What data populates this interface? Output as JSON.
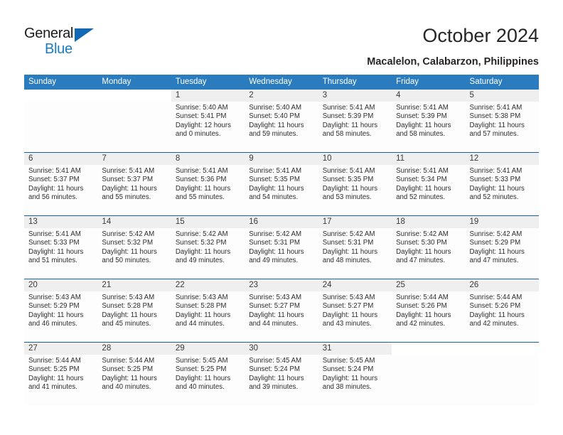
{
  "brand": {
    "name_top": "General",
    "name_bottom": "Blue",
    "accent_color": "#1a7dc4",
    "triangle_color": "#1268b3"
  },
  "header": {
    "title": "October 2024",
    "subtitle": "Macalelon, Calabarzon, Philippines"
  },
  "calendar": {
    "header_bg": "#2b7cbf",
    "header_text_color": "#ffffff",
    "row_divider_color": "#19629f",
    "day_number_band_color": "#efefef",
    "weekdays": [
      "Sunday",
      "Monday",
      "Tuesday",
      "Wednesday",
      "Thursday",
      "Friday",
      "Saturday"
    ],
    "weeks": [
      [
        {
          "day": "",
          "lines": []
        },
        {
          "day": "",
          "lines": []
        },
        {
          "day": "1",
          "lines": [
            "Sunrise: 5:40 AM",
            "Sunset: 5:41 PM",
            "Daylight: 12 hours",
            "and 0 minutes."
          ]
        },
        {
          "day": "2",
          "lines": [
            "Sunrise: 5:40 AM",
            "Sunset: 5:40 PM",
            "Daylight: 11 hours",
            "and 59 minutes."
          ]
        },
        {
          "day": "3",
          "lines": [
            "Sunrise: 5:41 AM",
            "Sunset: 5:39 PM",
            "Daylight: 11 hours",
            "and 58 minutes."
          ]
        },
        {
          "day": "4",
          "lines": [
            "Sunrise: 5:41 AM",
            "Sunset: 5:39 PM",
            "Daylight: 11 hours",
            "and 58 minutes."
          ]
        },
        {
          "day": "5",
          "lines": [
            "Sunrise: 5:41 AM",
            "Sunset: 5:38 PM",
            "Daylight: 11 hours",
            "and 57 minutes."
          ]
        }
      ],
      [
        {
          "day": "6",
          "lines": [
            "Sunrise: 5:41 AM",
            "Sunset: 5:37 PM",
            "Daylight: 11 hours",
            "and 56 minutes."
          ]
        },
        {
          "day": "7",
          "lines": [
            "Sunrise: 5:41 AM",
            "Sunset: 5:37 PM",
            "Daylight: 11 hours",
            "and 55 minutes."
          ]
        },
        {
          "day": "8",
          "lines": [
            "Sunrise: 5:41 AM",
            "Sunset: 5:36 PM",
            "Daylight: 11 hours",
            "and 55 minutes."
          ]
        },
        {
          "day": "9",
          "lines": [
            "Sunrise: 5:41 AM",
            "Sunset: 5:35 PM",
            "Daylight: 11 hours",
            "and 54 minutes."
          ]
        },
        {
          "day": "10",
          "lines": [
            "Sunrise: 5:41 AM",
            "Sunset: 5:35 PM",
            "Daylight: 11 hours",
            "and 53 minutes."
          ]
        },
        {
          "day": "11",
          "lines": [
            "Sunrise: 5:41 AM",
            "Sunset: 5:34 PM",
            "Daylight: 11 hours",
            "and 52 minutes."
          ]
        },
        {
          "day": "12",
          "lines": [
            "Sunrise: 5:41 AM",
            "Sunset: 5:33 PM",
            "Daylight: 11 hours",
            "and 52 minutes."
          ]
        }
      ],
      [
        {
          "day": "13",
          "lines": [
            "Sunrise: 5:41 AM",
            "Sunset: 5:33 PM",
            "Daylight: 11 hours",
            "and 51 minutes."
          ]
        },
        {
          "day": "14",
          "lines": [
            "Sunrise: 5:42 AM",
            "Sunset: 5:32 PM",
            "Daylight: 11 hours",
            "and 50 minutes."
          ]
        },
        {
          "day": "15",
          "lines": [
            "Sunrise: 5:42 AM",
            "Sunset: 5:32 PM",
            "Daylight: 11 hours",
            "and 49 minutes."
          ]
        },
        {
          "day": "16",
          "lines": [
            "Sunrise: 5:42 AM",
            "Sunset: 5:31 PM",
            "Daylight: 11 hours",
            "and 49 minutes."
          ]
        },
        {
          "day": "17",
          "lines": [
            "Sunrise: 5:42 AM",
            "Sunset: 5:31 PM",
            "Daylight: 11 hours",
            "and 48 minutes."
          ]
        },
        {
          "day": "18",
          "lines": [
            "Sunrise: 5:42 AM",
            "Sunset: 5:30 PM",
            "Daylight: 11 hours",
            "and 47 minutes."
          ]
        },
        {
          "day": "19",
          "lines": [
            "Sunrise: 5:42 AM",
            "Sunset: 5:29 PM",
            "Daylight: 11 hours",
            "and 47 minutes."
          ]
        }
      ],
      [
        {
          "day": "20",
          "lines": [
            "Sunrise: 5:43 AM",
            "Sunset: 5:29 PM",
            "Daylight: 11 hours",
            "and 46 minutes."
          ]
        },
        {
          "day": "21",
          "lines": [
            "Sunrise: 5:43 AM",
            "Sunset: 5:28 PM",
            "Daylight: 11 hours",
            "and 45 minutes."
          ]
        },
        {
          "day": "22",
          "lines": [
            "Sunrise: 5:43 AM",
            "Sunset: 5:28 PM",
            "Daylight: 11 hours",
            "and 44 minutes."
          ]
        },
        {
          "day": "23",
          "lines": [
            "Sunrise: 5:43 AM",
            "Sunset: 5:27 PM",
            "Daylight: 11 hours",
            "and 44 minutes."
          ]
        },
        {
          "day": "24",
          "lines": [
            "Sunrise: 5:43 AM",
            "Sunset: 5:27 PM",
            "Daylight: 11 hours",
            "and 43 minutes."
          ]
        },
        {
          "day": "25",
          "lines": [
            "Sunrise: 5:44 AM",
            "Sunset: 5:26 PM",
            "Daylight: 11 hours",
            "and 42 minutes."
          ]
        },
        {
          "day": "26",
          "lines": [
            "Sunrise: 5:44 AM",
            "Sunset: 5:26 PM",
            "Daylight: 11 hours",
            "and 42 minutes."
          ]
        }
      ],
      [
        {
          "day": "27",
          "lines": [
            "Sunrise: 5:44 AM",
            "Sunset: 5:25 PM",
            "Daylight: 11 hours",
            "and 41 minutes."
          ]
        },
        {
          "day": "28",
          "lines": [
            "Sunrise: 5:44 AM",
            "Sunset: 5:25 PM",
            "Daylight: 11 hours",
            "and 40 minutes."
          ]
        },
        {
          "day": "29",
          "lines": [
            "Sunrise: 5:45 AM",
            "Sunset: 5:25 PM",
            "Daylight: 11 hours",
            "and 40 minutes."
          ]
        },
        {
          "day": "30",
          "lines": [
            "Sunrise: 5:45 AM",
            "Sunset: 5:24 PM",
            "Daylight: 11 hours",
            "and 39 minutes."
          ]
        },
        {
          "day": "31",
          "lines": [
            "Sunrise: 5:45 AM",
            "Sunset: 5:24 PM",
            "Daylight: 11 hours",
            "and 38 minutes."
          ]
        },
        {
          "day": "",
          "lines": []
        },
        {
          "day": "",
          "lines": []
        }
      ]
    ]
  }
}
